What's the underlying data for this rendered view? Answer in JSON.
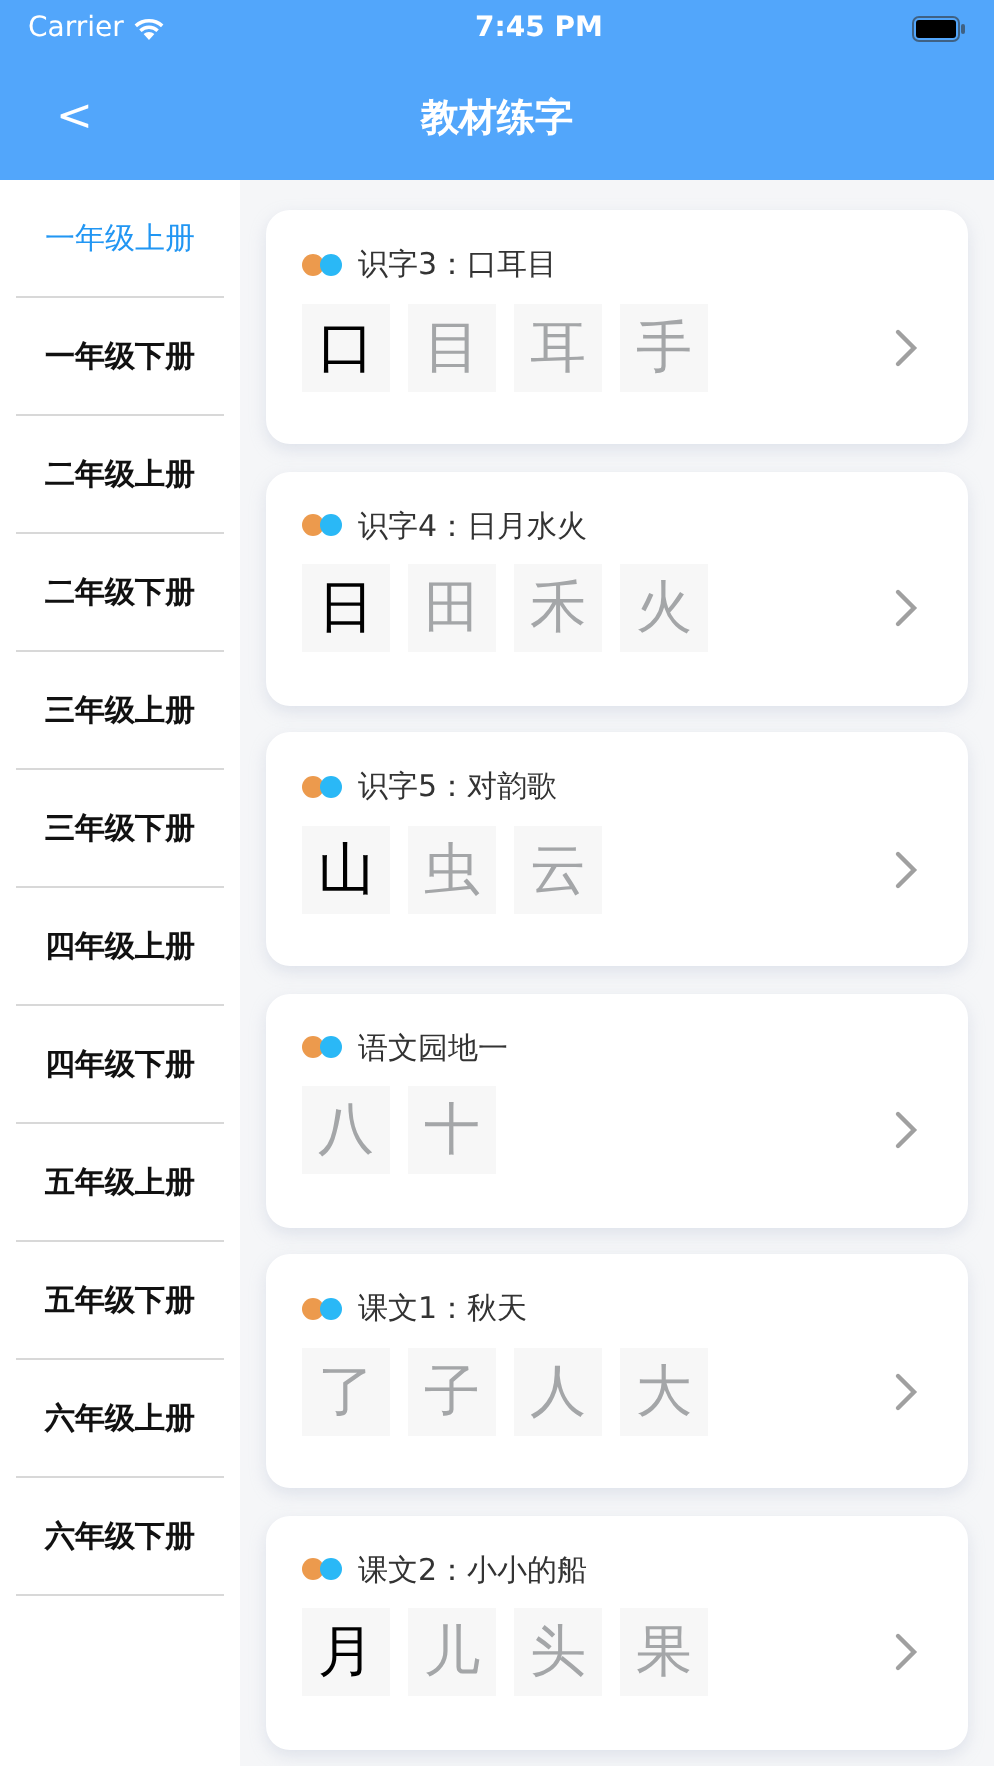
{
  "status_bar": {
    "carrier": "Carrier",
    "time": "7:45 PM"
  },
  "nav_bar": {
    "back": "<",
    "title": "教材练字"
  },
  "sidebar": {
    "items": [
      {
        "label": "一年级上册",
        "selected": true
      },
      {
        "label": "一年级下册",
        "selected": false
      },
      {
        "label": "二年级上册",
        "selected": false
      },
      {
        "label": "二年级下册",
        "selected": false
      },
      {
        "label": "三年级上册",
        "selected": false
      },
      {
        "label": "三年级下册",
        "selected": false
      },
      {
        "label": "四年级上册",
        "selected": false
      },
      {
        "label": "四年级下册",
        "selected": false
      },
      {
        "label": "五年级上册",
        "selected": false
      },
      {
        "label": "五年级下册",
        "selected": false
      },
      {
        "label": "六年级上册",
        "selected": false
      },
      {
        "label": "六年级下册",
        "selected": false
      }
    ]
  },
  "lessons": [
    {
      "title": "识字3：口耳目",
      "chars": [
        {
          "char": "口",
          "learned": true
        },
        {
          "char": "目",
          "learned": false
        },
        {
          "char": "耳",
          "learned": false
        },
        {
          "char": "手",
          "learned": false
        }
      ]
    },
    {
      "title": "识字4：日月水火",
      "chars": [
        {
          "char": "日",
          "learned": true
        },
        {
          "char": "田",
          "learned": false
        },
        {
          "char": "禾",
          "learned": false
        },
        {
          "char": "火",
          "learned": false
        }
      ]
    },
    {
      "title": "识字5：对韵歌",
      "chars": [
        {
          "char": "山",
          "learned": true
        },
        {
          "char": "虫",
          "learned": false
        },
        {
          "char": "云",
          "learned": false
        }
      ]
    },
    {
      "title": "语文园地一",
      "chars": [
        {
          "char": "八",
          "learned": false
        },
        {
          "char": "十",
          "learned": false
        }
      ]
    },
    {
      "title": "课文1：秋天",
      "chars": [
        {
          "char": "了",
          "learned": false
        },
        {
          "char": "子",
          "learned": false
        },
        {
          "char": "人",
          "learned": false
        },
        {
          "char": "大",
          "learned": false
        }
      ]
    },
    {
      "title": "课文2：小小的船",
      "chars": [
        {
          "char": "月",
          "learned": true
        },
        {
          "char": "儿",
          "learned": false
        },
        {
          "char": "头",
          "learned": false
        },
        {
          "char": "果",
          "learned": false
        }
      ]
    }
  ]
}
